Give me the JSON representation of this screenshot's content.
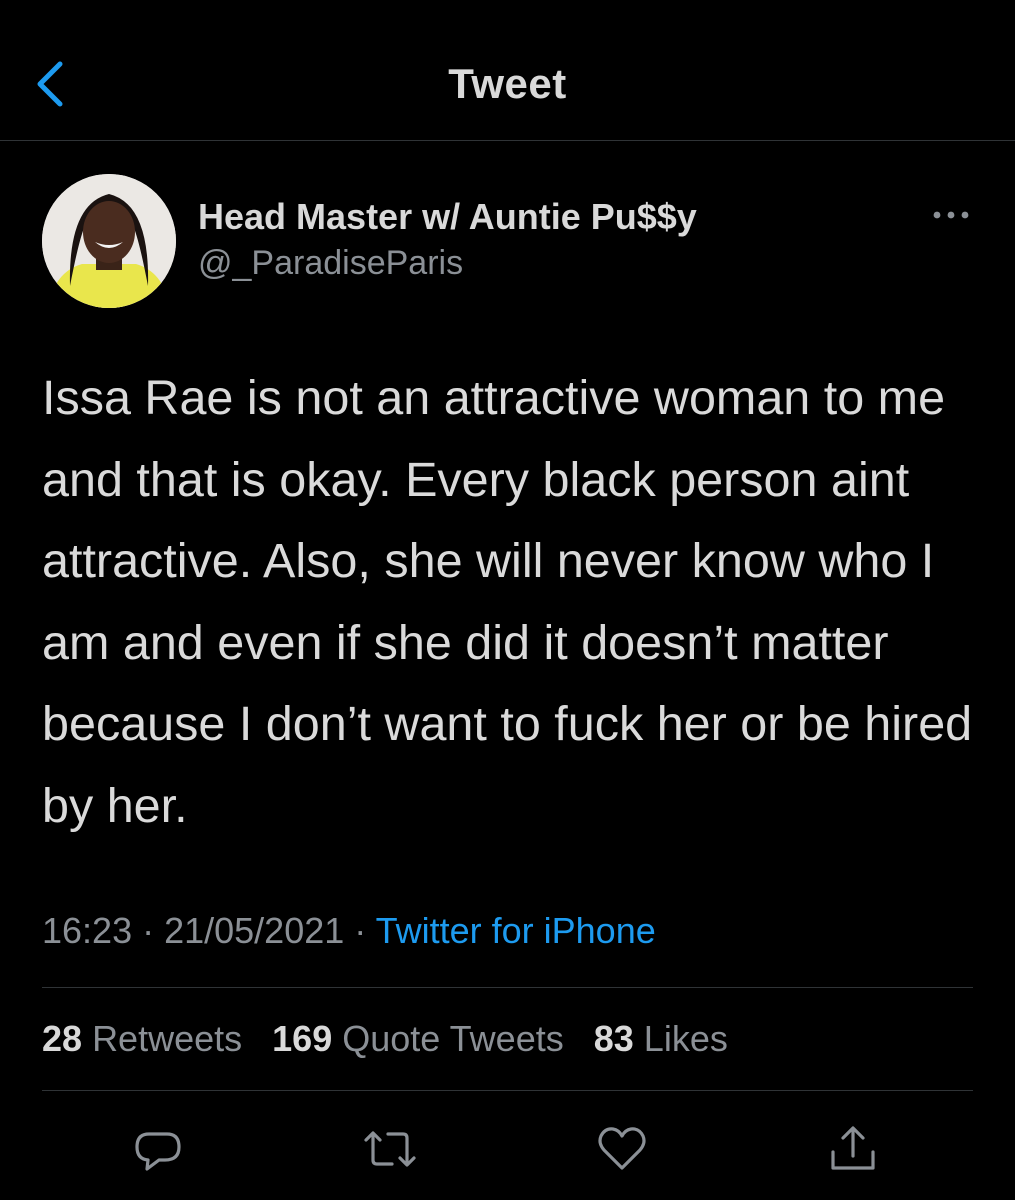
{
  "header": {
    "title": "Tweet",
    "back_icon": "chevron-left-icon"
  },
  "author": {
    "display_name": "Head Master w/ Auntie Pu$$y",
    "handle": "@_ParadiseParis"
  },
  "tweet": {
    "text": "Issa Rae is not an attractive woman to me and that is okay. Every black person aint attractive. Also, she will never know who I am and even if she did it doesn’t matter because I don’t want to fuck her or be hired by her.",
    "time": "16:23",
    "date": "21/05/2021",
    "separator": " · ",
    "source": "Twitter for iPhone"
  },
  "stats": {
    "retweets_count": "28",
    "retweets_label": "Retweets",
    "quotes_count": "169",
    "quotes_label": "Quote Tweets",
    "likes_count": "83",
    "likes_label": "Likes"
  },
  "actions": [
    "reply-icon",
    "retweet-icon",
    "like-icon",
    "share-icon"
  ],
  "colors": {
    "background": "#000000",
    "text": "#d9d9d9",
    "secondary": "#8b9096",
    "accent": "#1d9bf0",
    "divider": "#2f3336"
  }
}
